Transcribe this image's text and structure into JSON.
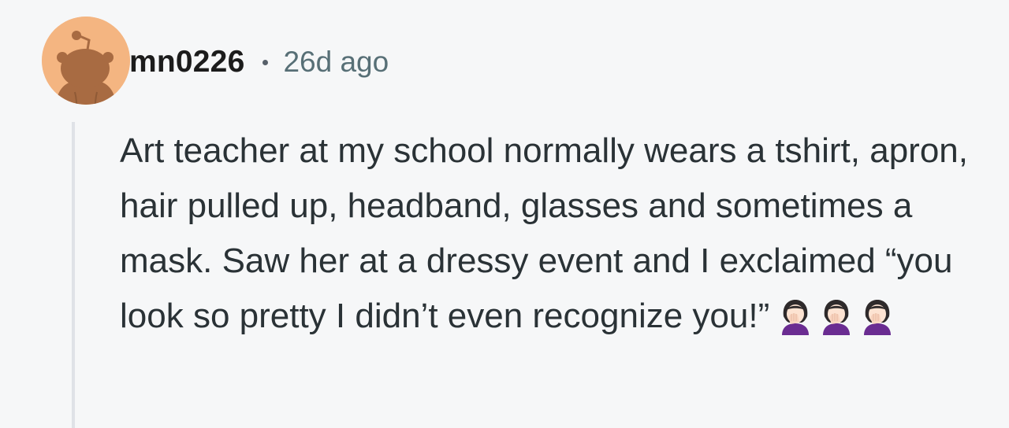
{
  "comment": {
    "username": "mn0226",
    "separator_icon": "dot-separator-icon",
    "time_ago": "26d ago",
    "avatar_icon": "snoo-avatar-icon",
    "body": "Art teacher at my school normally wears a tshirt, apron, hair pulled up, headband, glasses and sometimes a mask. Saw her at a dressy event and I exclaimed “you look so pretty I didn’t even recognize you!”",
    "reaction_emojis": [
      "woman-facepalming-emoji",
      "woman-facepalming-emoji",
      "woman-facepalming-emoji"
    ]
  },
  "colors": {
    "background": "#f6f7f8",
    "avatar_bg": "#f4b581",
    "snoo_brown": "#a86b42",
    "thread_line": "#dfe2e7",
    "username": "#1c1c1c",
    "meta_text": "#576f76",
    "body_text": "#2a3236"
  }
}
